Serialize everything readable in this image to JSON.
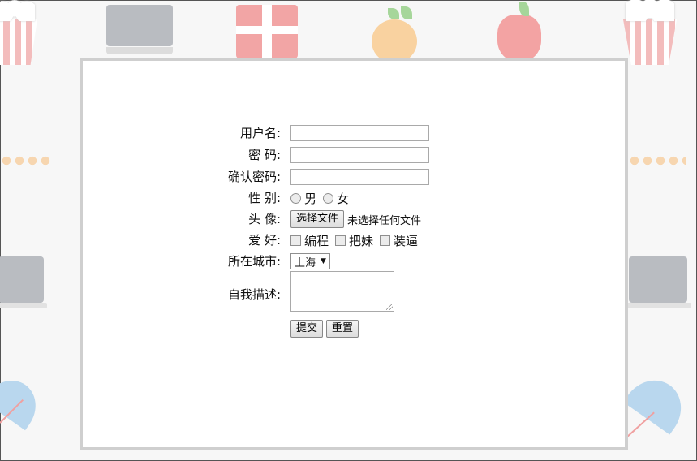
{
  "form": {
    "username": {
      "label": "用户名:",
      "value": ""
    },
    "password": {
      "label": "密 码:",
      "value": ""
    },
    "confirm_password": {
      "label": "确认密码:",
      "value": ""
    },
    "gender": {
      "label": "性 别:",
      "options": [
        "男",
        "女"
      ]
    },
    "avatar": {
      "label": "头 像:",
      "button": "选择文件",
      "status": "未选择任何文件"
    },
    "hobbies": {
      "label": "爱 好:",
      "options": [
        "编程",
        "把妹",
        "装逼"
      ]
    },
    "city": {
      "label": "所在城市:",
      "selected": "上海"
    },
    "description": {
      "label": "自我描述:",
      "value": ""
    },
    "submit_label": "提交",
    "reset_label": "重置"
  },
  "colors": {
    "panel_border": "#cfcfcf",
    "background": "#f7f7f7"
  }
}
